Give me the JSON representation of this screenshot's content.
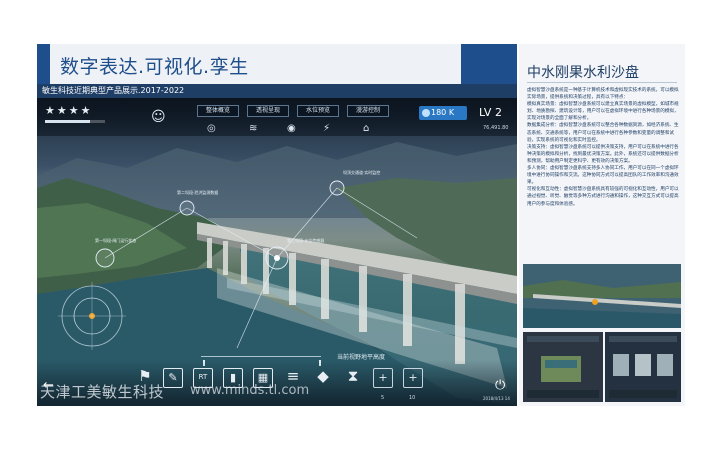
{
  "header": {
    "title": "数字表达.可视化.孪生",
    "subtitle": "敏生科技近期典型产品展示.2017-2022"
  },
  "hud": {
    "rating": "★★★★",
    "meter_level": 0.75,
    "tabs": [
      {
        "label": "整体概览"
      },
      {
        "label": "透视呈现"
      },
      {
        "label": "水位预览"
      },
      {
        "label": "漫游控制"
      }
    ],
    "weather_value": "180 K",
    "level": "LV 2",
    "coords": "76,491.80"
  },
  "scene": {
    "slider_caption": "当前视野地平高度",
    "labels": [
      "第一坝段·闸门运行状态",
      "第二坝段·泄洪监测数据",
      "第三坝段·水位传感器",
      "坝顶交通道·实时监控"
    ]
  },
  "toolbar": {
    "tools": [
      {
        "icon": "flag-icon",
        "glyph": "⚑"
      },
      {
        "icon": "edit-icon",
        "glyph": "✎"
      },
      {
        "icon": "text-icon",
        "glyph": "RT"
      },
      {
        "icon": "bar-chart-icon",
        "glyph": "▮"
      },
      {
        "icon": "film-icon",
        "glyph": "▦"
      },
      {
        "icon": "database-icon",
        "glyph": "≡"
      },
      {
        "icon": "cube-icon",
        "glyph": "◆"
      },
      {
        "icon": "hourglass-icon",
        "glyph": "⧗"
      },
      {
        "icon": "plus-icon",
        "glyph": "+"
      },
      {
        "icon": "plus-icon",
        "glyph": "+"
      }
    ],
    "numbers": [
      "5",
      "10"
    ],
    "date": "2018/4/13 14"
  },
  "watermark": {
    "company": "天津工美敏生科技",
    "url": "www.minds.tl.com"
  },
  "right_panel": {
    "title": "中水刚果水利沙盘",
    "paragraphs": [
      "虚拟智慧沙盘系统是一种基于计算机技术和虚拟现实技术的系统，可以模拟实际场景，提供系统和决策过程，具有以下特点：",
      "模拟真实场景：虚拟智慧沙盘系统可以建立真实场景的虚拟模型，如城市规划、地质勘探、建筑设计等，用户可以在虚拟环境中进行各种场景的模拟，实现对场景的全面了解和分析。",
      "数据集成分析：虚拟智慧沙盘系统可以整合各种数据资源，如经济系统、生态系统、交通系统等，用户可以在系统中进行各种参数和变量的调整和试验，实现系统的可视化和实时监控。",
      "决策支持：虚拟智慧沙盘系统可以提供决策支持，用户可以在系统中进行各种决策的模拟和分析，找到最优决策方案。此外，系统还可以提供数据分析和预测，帮助用户制定更科学、更有效的决策方案。",
      "多人协同：虚拟智慧沙盘系统支持多人协同工作，用户可以在同一个虚拟环境中进行协同操作和交流。这种协同方式可以提高团队的工作效率和沟通效果。",
      "可视化和互动性：虚拟智慧沙盘系统具有较强的可视化和互动性，用户可以通过视觉、听觉、触觉等多种方式进行沟通和操作，这种交互方式可以提高用户的参与度和体验感。"
    ]
  }
}
